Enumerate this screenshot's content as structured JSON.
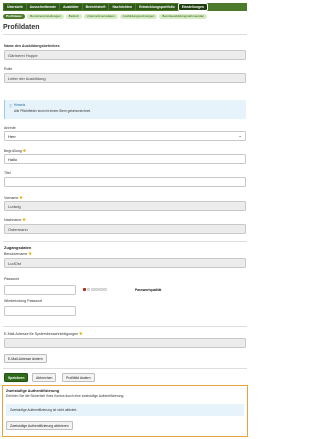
{
  "nav": {
    "tabs": [
      "Übersicht",
      "Ausschreibende",
      "Ausbilder",
      "Berichtsheft",
      "Nachrichten",
      "Entwicklungsportfolio",
      "Einstellungen"
    ],
    "active_index": 6
  },
  "subnav": {
    "tabs": [
      "Profildaten",
      "Benutzereinstellungen",
      "Betrieb",
      "Unternehmensdaten",
      "Ausbildungsordnungen",
      "Berufsausbildungsrahmenplan"
    ],
    "active_index": 0
  },
  "page": {
    "title": "Profildaten"
  },
  "company": {
    "label": "Name des Ausbildungsbetriebes",
    "value": "Gärtnerei Hoppe"
  },
  "role": {
    "label": "Rolle",
    "value": "Leiter der Ausbildung"
  },
  "notice": {
    "title": "Hinweis",
    "text": "Alle Pflichtfelder sind mit einem Stern gekennzeichnet.",
    "icon": "info-icon"
  },
  "salutation": {
    "label": "Anrede",
    "value": "Herr"
  },
  "greeting": {
    "label": "Begrüßung",
    "value": "Hallo"
  },
  "title_field": {
    "label": "Titel",
    "value": ""
  },
  "firstname": {
    "label": "Vorname",
    "value": "Ludwig"
  },
  "lastname": {
    "label": "Nachname",
    "value": "Ostermann"
  },
  "access": {
    "heading": "Zugangsdaten",
    "username_label": "Benutzername",
    "username_value": "LudOst",
    "password_label": "Passwort",
    "password_quality_label": "Passwortqualität",
    "password_quality_level": 1,
    "password_quality_max": 6,
    "repeat_label": "Wiederholung Passwort"
  },
  "email": {
    "label": "E-Mail-Adresse für Systembenachrichtigungen",
    "value": "",
    "change_label": "E-Mail-Adresse ändern"
  },
  "actions": {
    "save": "Speichern",
    "cancel": "Abbrechen",
    "change_profile": "Profilbild ändern"
  },
  "twofa": {
    "title": "Zweistufige Authentifizierung",
    "text": "Erhöhen Sie die Sicherheit Ihres Kontos durch eine zweistufige Authentifizierung.",
    "status": "Zweistufige Authentifizierung ist nicht aktiviert.",
    "activate_label": "Zweistufige Authentifizierung aktivieren"
  },
  "colors": {
    "nav_green": "#4a7a2a",
    "accent_orange": "#e8a33c",
    "info_blue": "#e6f3fb",
    "required_star": "#e0b000"
  }
}
